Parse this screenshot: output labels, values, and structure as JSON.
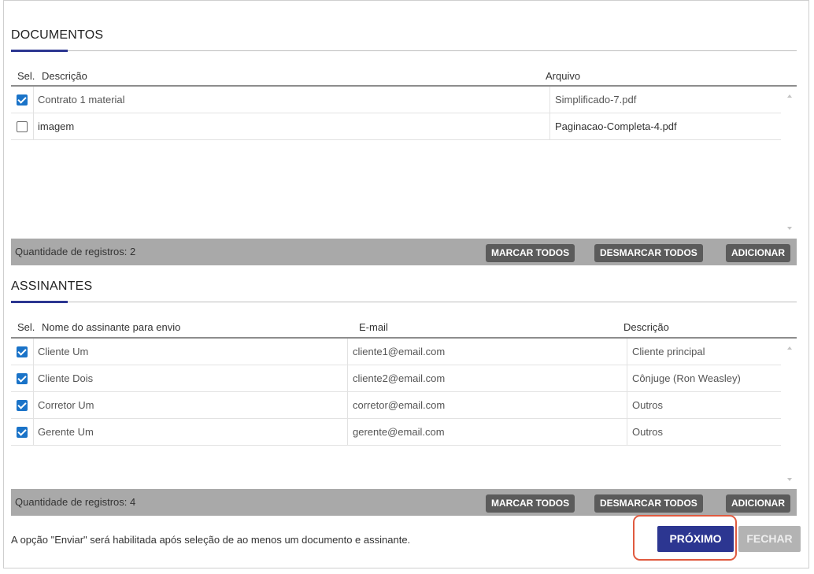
{
  "documents": {
    "title": "DOCUMENTOS",
    "headers": {
      "sel": "Sel.",
      "descricao": "Descrição",
      "arquivo": "Arquivo"
    },
    "rows": [
      {
        "checked": true,
        "descricao": "Contrato 1 material",
        "arquivo": "Simplificado-7.pdf"
      },
      {
        "checked": false,
        "descricao": "imagem",
        "arquivo": "Paginacao-Completa-4.pdf"
      }
    ],
    "count_label": "Quantidade de registros: 2",
    "buttons": {
      "select_all": "MARCAR TODOS",
      "deselect_all": "DESMARCAR TODOS",
      "add": "ADICIONAR"
    }
  },
  "signers": {
    "title": "ASSINANTES",
    "headers": {
      "sel": "Sel.",
      "nome": "Nome do assinante para envio",
      "email": "E-mail",
      "descricao": "Descrição"
    },
    "rows": [
      {
        "checked": true,
        "nome": "Cliente Um",
        "email": "cliente1@email.com",
        "descricao": "Cliente principal"
      },
      {
        "checked": true,
        "nome": "Cliente Dois",
        "email": "cliente2@email.com",
        "descricao": "Cônjuge (Ron Weasley)"
      },
      {
        "checked": true,
        "nome": "Corretor Um",
        "email": "corretor@email.com",
        "descricao": "Outros"
      },
      {
        "checked": true,
        "nome": "Gerente Um",
        "email": "gerente@email.com",
        "descricao": "Outros"
      }
    ],
    "count_label": "Quantidade de registros: 4",
    "buttons": {
      "select_all": "MARCAR TODOS",
      "deselect_all": "DESMARCAR TODOS",
      "add": "ADICIONAR"
    }
  },
  "footer": {
    "hint": "A opção \"Enviar\" será habilitada após seleção de ao menos um documento e assinante.",
    "next_label": "PRÓXIMO",
    "close_label": "FECHAR"
  },
  "colors": {
    "accent": "#2c3691",
    "checkbox": "#1a73c8",
    "highlight": "#e05a3f"
  }
}
